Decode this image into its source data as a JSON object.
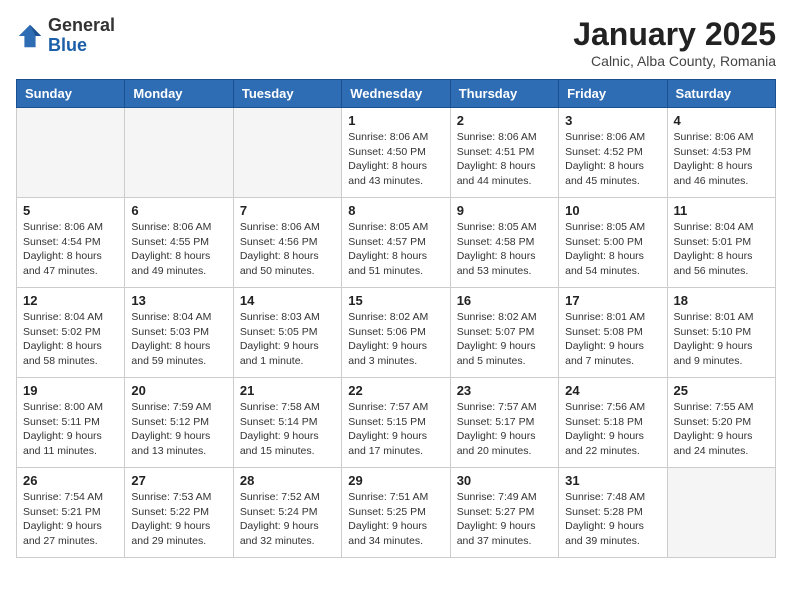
{
  "header": {
    "logo_general": "General",
    "logo_blue": "Blue",
    "title": "January 2025",
    "subtitle": "Calnic, Alba County, Romania"
  },
  "days_of_week": [
    "Sunday",
    "Monday",
    "Tuesday",
    "Wednesday",
    "Thursday",
    "Friday",
    "Saturday"
  ],
  "weeks": [
    [
      {
        "day": "",
        "info": ""
      },
      {
        "day": "",
        "info": ""
      },
      {
        "day": "",
        "info": ""
      },
      {
        "day": "1",
        "info": "Sunrise: 8:06 AM\nSunset: 4:50 PM\nDaylight: 8 hours and 43 minutes."
      },
      {
        "day": "2",
        "info": "Sunrise: 8:06 AM\nSunset: 4:51 PM\nDaylight: 8 hours and 44 minutes."
      },
      {
        "day": "3",
        "info": "Sunrise: 8:06 AM\nSunset: 4:52 PM\nDaylight: 8 hours and 45 minutes."
      },
      {
        "day": "4",
        "info": "Sunrise: 8:06 AM\nSunset: 4:53 PM\nDaylight: 8 hours and 46 minutes."
      }
    ],
    [
      {
        "day": "5",
        "info": "Sunrise: 8:06 AM\nSunset: 4:54 PM\nDaylight: 8 hours and 47 minutes."
      },
      {
        "day": "6",
        "info": "Sunrise: 8:06 AM\nSunset: 4:55 PM\nDaylight: 8 hours and 49 minutes."
      },
      {
        "day": "7",
        "info": "Sunrise: 8:06 AM\nSunset: 4:56 PM\nDaylight: 8 hours and 50 minutes."
      },
      {
        "day": "8",
        "info": "Sunrise: 8:05 AM\nSunset: 4:57 PM\nDaylight: 8 hours and 51 minutes."
      },
      {
        "day": "9",
        "info": "Sunrise: 8:05 AM\nSunset: 4:58 PM\nDaylight: 8 hours and 53 minutes."
      },
      {
        "day": "10",
        "info": "Sunrise: 8:05 AM\nSunset: 5:00 PM\nDaylight: 8 hours and 54 minutes."
      },
      {
        "day": "11",
        "info": "Sunrise: 8:04 AM\nSunset: 5:01 PM\nDaylight: 8 hours and 56 minutes."
      }
    ],
    [
      {
        "day": "12",
        "info": "Sunrise: 8:04 AM\nSunset: 5:02 PM\nDaylight: 8 hours and 58 minutes."
      },
      {
        "day": "13",
        "info": "Sunrise: 8:04 AM\nSunset: 5:03 PM\nDaylight: 8 hours and 59 minutes."
      },
      {
        "day": "14",
        "info": "Sunrise: 8:03 AM\nSunset: 5:05 PM\nDaylight: 9 hours and 1 minute."
      },
      {
        "day": "15",
        "info": "Sunrise: 8:02 AM\nSunset: 5:06 PM\nDaylight: 9 hours and 3 minutes."
      },
      {
        "day": "16",
        "info": "Sunrise: 8:02 AM\nSunset: 5:07 PM\nDaylight: 9 hours and 5 minutes."
      },
      {
        "day": "17",
        "info": "Sunrise: 8:01 AM\nSunset: 5:08 PM\nDaylight: 9 hours and 7 minutes."
      },
      {
        "day": "18",
        "info": "Sunrise: 8:01 AM\nSunset: 5:10 PM\nDaylight: 9 hours and 9 minutes."
      }
    ],
    [
      {
        "day": "19",
        "info": "Sunrise: 8:00 AM\nSunset: 5:11 PM\nDaylight: 9 hours and 11 minutes."
      },
      {
        "day": "20",
        "info": "Sunrise: 7:59 AM\nSunset: 5:12 PM\nDaylight: 9 hours and 13 minutes."
      },
      {
        "day": "21",
        "info": "Sunrise: 7:58 AM\nSunset: 5:14 PM\nDaylight: 9 hours and 15 minutes."
      },
      {
        "day": "22",
        "info": "Sunrise: 7:57 AM\nSunset: 5:15 PM\nDaylight: 9 hours and 17 minutes."
      },
      {
        "day": "23",
        "info": "Sunrise: 7:57 AM\nSunset: 5:17 PM\nDaylight: 9 hours and 20 minutes."
      },
      {
        "day": "24",
        "info": "Sunrise: 7:56 AM\nSunset: 5:18 PM\nDaylight: 9 hours and 22 minutes."
      },
      {
        "day": "25",
        "info": "Sunrise: 7:55 AM\nSunset: 5:20 PM\nDaylight: 9 hours and 24 minutes."
      }
    ],
    [
      {
        "day": "26",
        "info": "Sunrise: 7:54 AM\nSunset: 5:21 PM\nDaylight: 9 hours and 27 minutes."
      },
      {
        "day": "27",
        "info": "Sunrise: 7:53 AM\nSunset: 5:22 PM\nDaylight: 9 hours and 29 minutes."
      },
      {
        "day": "28",
        "info": "Sunrise: 7:52 AM\nSunset: 5:24 PM\nDaylight: 9 hours and 32 minutes."
      },
      {
        "day": "29",
        "info": "Sunrise: 7:51 AM\nSunset: 5:25 PM\nDaylight: 9 hours and 34 minutes."
      },
      {
        "day": "30",
        "info": "Sunrise: 7:49 AM\nSunset: 5:27 PM\nDaylight: 9 hours and 37 minutes."
      },
      {
        "day": "31",
        "info": "Sunrise: 7:48 AM\nSunset: 5:28 PM\nDaylight: 9 hours and 39 minutes."
      },
      {
        "day": "",
        "info": ""
      }
    ]
  ]
}
